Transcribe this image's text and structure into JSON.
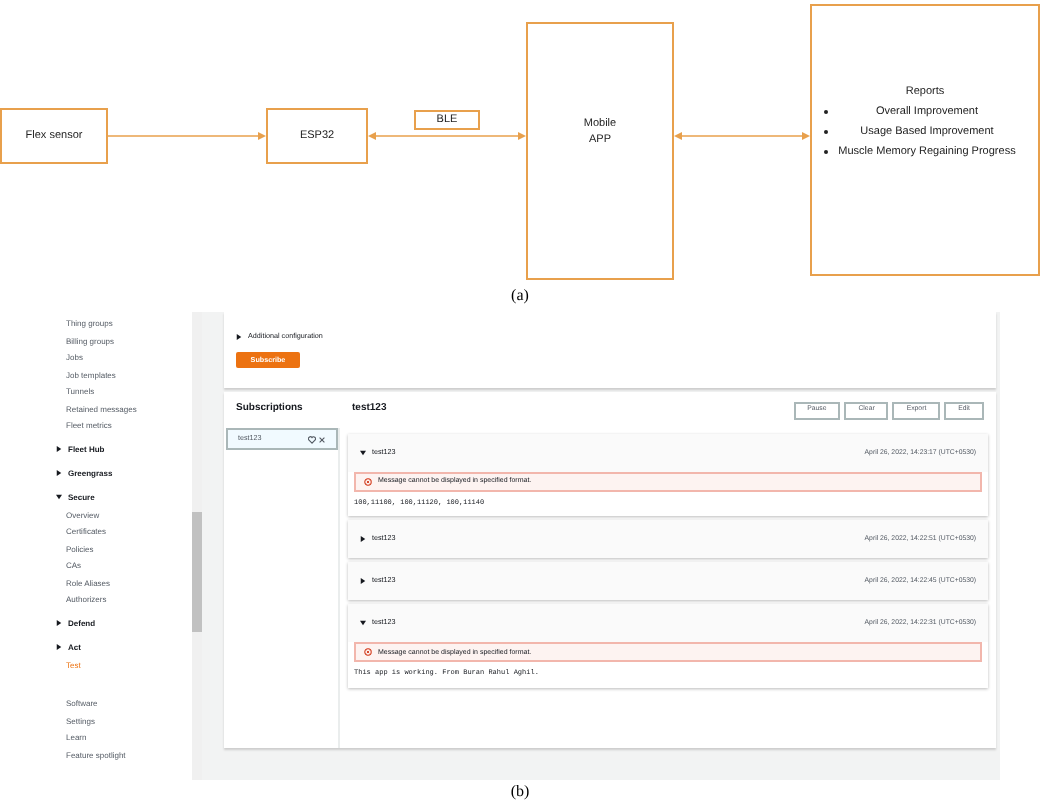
{
  "diagram": {
    "nodes": [
      {
        "label": "Flex sensor"
      },
      {
        "label": "ESP32"
      },
      {
        "label": "Mobile\nAPP"
      }
    ],
    "link_label": "BLE",
    "reports": {
      "title": "Reports",
      "items": [
        "Overall Improvement",
        "Usage Based Improvement",
        "Muscle Memory Regaining Progress"
      ]
    },
    "caption": "(a)"
  },
  "console": {
    "sidebar": [
      {
        "kind": "link",
        "label": "Thing groups",
        "selected": false
      },
      {
        "kind": "link",
        "label": "Billing groups",
        "selected": false
      },
      {
        "kind": "link",
        "label": "Jobs",
        "selected": false
      },
      {
        "kind": "link",
        "label": "Job templates",
        "selected": false
      },
      {
        "kind": "link",
        "label": "Tunnels",
        "selected": false
      },
      {
        "kind": "link",
        "label": "Retained messages",
        "selected": false
      },
      {
        "kind": "link",
        "label": "Fleet metrics",
        "selected": false
      },
      {
        "kind": "group",
        "label": "Fleet Hub",
        "expanded": false
      },
      {
        "kind": "group",
        "label": "Greengrass",
        "expanded": false
      },
      {
        "kind": "group",
        "label": "Secure",
        "expanded": true,
        "children": [
          {
            "label": "Overview",
            "selected": false
          },
          {
            "label": "Certificates",
            "selected": false
          },
          {
            "label": "Policies",
            "selected": false
          },
          {
            "label": "CAs",
            "selected": false
          },
          {
            "label": "Role Aliases",
            "selected": false
          },
          {
            "label": "Authorizers",
            "selected": false
          }
        ]
      },
      {
        "kind": "group",
        "label": "Defend",
        "expanded": false
      },
      {
        "kind": "group",
        "label": "Act",
        "expanded": false
      },
      {
        "kind": "link",
        "label": "Test",
        "selected": true
      },
      {
        "kind": "gap"
      },
      {
        "kind": "link",
        "label": "Software",
        "selected": false
      },
      {
        "kind": "link",
        "label": "Settings",
        "selected": false
      },
      {
        "kind": "link",
        "label": "Learn",
        "selected": false
      },
      {
        "kind": "link",
        "label": "Feature spotlight",
        "selected": false
      }
    ],
    "additional_configuration": {
      "label": "Additional configuration",
      "expanded": false
    },
    "subscribe_button": "Subscribe",
    "subscriptions_title": "Subscriptions",
    "subscriptions": [
      {
        "topic": "test123",
        "selected": true
      }
    ],
    "topic_title": "test123",
    "buttons": [
      "Pause",
      "Clear",
      "Export",
      "Edit"
    ],
    "messages": [
      {
        "topic": "test123",
        "time": "April 26, 2022, 14:23:17 (UTC+0530)",
        "expanded": true,
        "error": "Message cannot be displayed in specified format.",
        "payload": "100,11100, 100,11120, 100,11140"
      },
      {
        "topic": "test123",
        "time": "April 26, 2022, 14:22:51 (UTC+0530)",
        "expanded": false
      },
      {
        "topic": "test123",
        "time": "April 26, 2022, 14:22:45 (UTC+0530)",
        "expanded": false
      },
      {
        "topic": "test123",
        "time": "April 26, 2022, 14:22:31 (UTC+0530)",
        "expanded": true,
        "error": "Message cannot be displayed in specified format.",
        "payload": "This app is working. From Buran Rahul Aghil."
      }
    ]
  },
  "caption": "(b)"
}
